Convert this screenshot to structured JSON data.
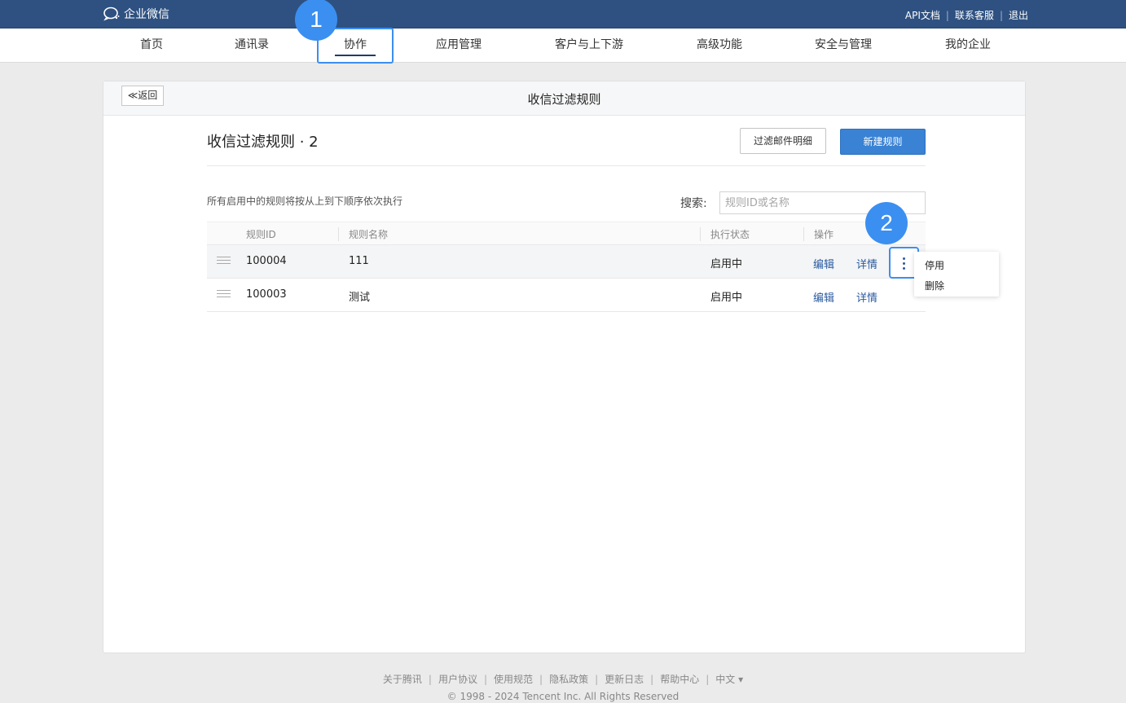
{
  "topbar": {
    "logo_text": "企业微信",
    "links": [
      {
        "label": "API文档"
      },
      {
        "label": "联系客服"
      },
      {
        "label": "退出"
      }
    ]
  },
  "nav": {
    "items": [
      {
        "label": "首页"
      },
      {
        "label": "通讯录"
      },
      {
        "label": "协作"
      },
      {
        "label": "应用管理"
      },
      {
        "label": "客户与上下游"
      },
      {
        "label": "高级功能"
      },
      {
        "label": "安全与管理"
      },
      {
        "label": "我的企业"
      }
    ],
    "active_index": 2
  },
  "markers": [
    "1",
    "2"
  ],
  "page": {
    "back_label": "≪返回",
    "header_title": "收信过滤规则",
    "section_title": "收信过滤规则 · 2",
    "filter_button": "过滤邮件明细",
    "new_button": "新建规则",
    "hint": "所有启用中的规则将按从上到下顺序依次执行",
    "search_label": "搜索:",
    "search_placeholder": "规则ID或名称"
  },
  "table": {
    "headers": {
      "id": "规则ID",
      "name": "规则名称",
      "status": "执行状态",
      "ops": "操作"
    },
    "rows": [
      {
        "id": "100004",
        "name": "111",
        "status": "启用中",
        "edit": "编辑",
        "detail": "详情"
      },
      {
        "id": "100003",
        "name": "测试",
        "status": "启用中",
        "edit": "编辑",
        "detail": "详情"
      }
    ]
  },
  "dropdown": {
    "items": [
      "停用",
      "删除"
    ]
  },
  "footer": {
    "links": [
      "关于腾讯",
      "用户协议",
      "使用规范",
      "隐私政策",
      "更新日志",
      "帮助中心",
      "中文 ▾"
    ],
    "copyright": "© 1998 - 2024 Tencent Inc. All Rights Reserved"
  },
  "colors": {
    "topbar": "#2e5181",
    "accent": "#3b8ff0",
    "primary_button": "#3982d4",
    "link": "#2a5aa0"
  }
}
